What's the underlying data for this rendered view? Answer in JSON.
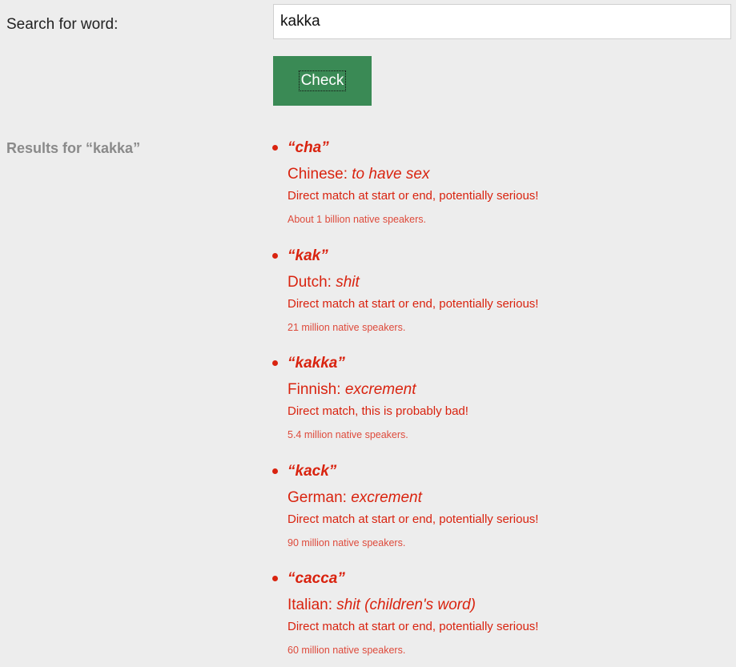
{
  "search": {
    "label": "Search for word:",
    "value": "kakka",
    "button_label": "Check"
  },
  "results": {
    "heading": "Results for “kakka”",
    "items": [
      {
        "word": "“cha”",
        "language": "Chinese: ",
        "meaning": "to have sex",
        "match": "Direct match at start or end, potentially serious!",
        "speakers": "About 1 billion native speakers."
      },
      {
        "word": "“kak”",
        "language": "Dutch: ",
        "meaning": "shit",
        "match": "Direct match at start or end, potentially serious!",
        "speakers": "21 million native speakers."
      },
      {
        "word": "“kakka”",
        "language": "Finnish: ",
        "meaning": "excrement",
        "match": "Direct match, this is probably bad!",
        "speakers": "5.4 million native speakers."
      },
      {
        "word": "“kack”",
        "language": "German: ",
        "meaning": "excrement",
        "match": "Direct match at start or end, potentially serious!",
        "speakers": "90 million native speakers."
      },
      {
        "word": "“cacca”",
        "language": "Italian: ",
        "meaning": "shit (children's word)",
        "match": "Direct match at start or end, potentially serious!",
        "speakers": "60 million native speakers."
      }
    ]
  },
  "colors": {
    "background": "#ededed",
    "button": "#3a8a55",
    "result_text": "#d9230f",
    "heading_gray": "#8a8a8a"
  }
}
